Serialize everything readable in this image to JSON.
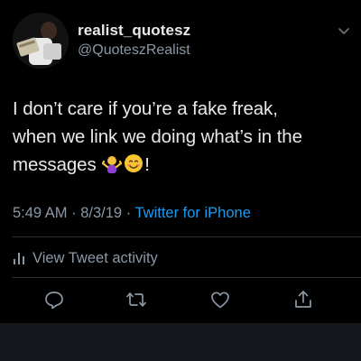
{
  "tweet": {
    "display_name": "realist_quotesz",
    "handle": "@QuoteszRealist",
    "text_lines": [
      "I don’t care if you’re a fake freak,",
      "when we link we doing what’s in the",
      "messages",
      "!"
    ],
    "emojis": [
      "person-shrugging-icon",
      "smiling-face-icon"
    ],
    "time": "5:49 AM",
    "separator": "·",
    "date": "8/3/19",
    "source": "Twitter for iPhone",
    "activity_label": "View Tweet activity"
  },
  "actions": [
    "reply-icon",
    "retweet-icon",
    "like-icon",
    "share-icon"
  ],
  "colors": {
    "background": "#000000",
    "text": "#e7e9ea",
    "secondary": "#8b98a5",
    "accent": "#1d9bf0",
    "divider": "#2f3336"
  }
}
